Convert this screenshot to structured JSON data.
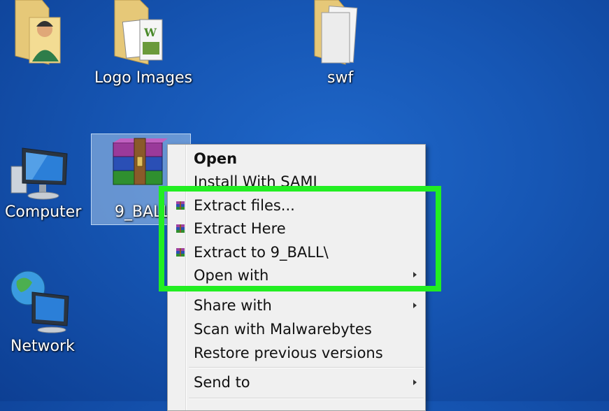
{
  "desktop": {
    "icons": [
      {
        "label": "Logo Images"
      },
      {
        "label": "swf"
      },
      {
        "label": "Computer"
      },
      {
        "label": "Network"
      },
      {
        "label": "9_BALL"
      }
    ]
  },
  "context_menu": {
    "items": [
      {
        "label": "Open",
        "bold": true
      },
      {
        "label": "Install With SAMI"
      },
      {
        "label": "Extract files...",
        "icon": "winrar-icon"
      },
      {
        "label": "Extract Here",
        "icon": "winrar-icon"
      },
      {
        "label": "Extract to 9_BALL\\",
        "icon": "winrar-icon"
      },
      {
        "label": "Open with",
        "submenu": true
      },
      {
        "label": "Share with",
        "submenu": true
      },
      {
        "label": "Scan with Malwarebytes"
      },
      {
        "label": "Restore previous versions"
      },
      {
        "label": "Send to",
        "submenu": true
      }
    ]
  },
  "colors": {
    "highlight": "#22ee22",
    "desktop_blue": "#1656b4"
  }
}
